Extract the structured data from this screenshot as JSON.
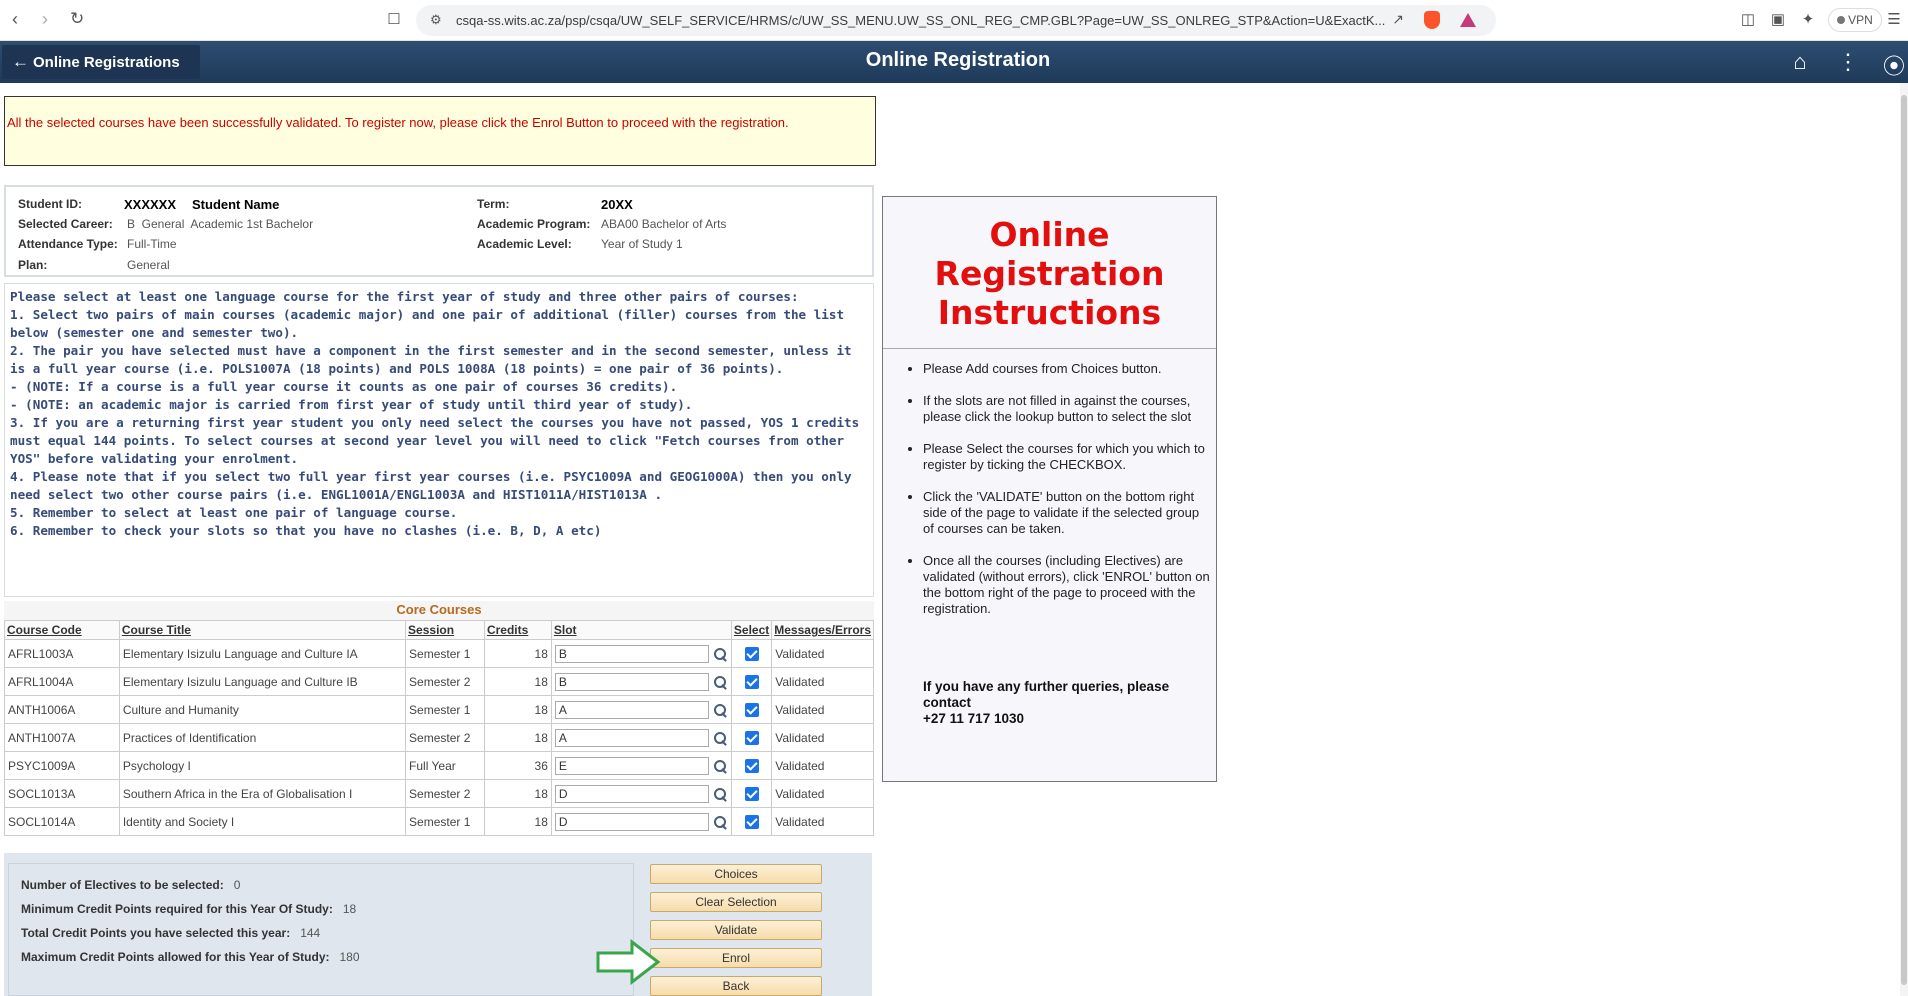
{
  "browser": {
    "url": "csqa-ss.wits.ac.za/psp/csqa/UW_SELF_SERVICE/HRMS/c/UW_SS_MENU.UW_SS_ONL_REG_CMP.GBL?Page=UW_SS_ONLREG_STP&Action=U&ExactK...",
    "vpn_label": "VPN"
  },
  "header": {
    "back_label": "Online Registrations",
    "title": "Online Registration"
  },
  "message": "All the selected courses have been successfully validated. To register now, please click the Enrol Button to proceed with the registration.",
  "student": {
    "id_label": "Student ID:",
    "id_value": "XXXXXX",
    "name_value": "Student Name",
    "career_label": "Selected Career:",
    "career_value": "B  General  Academic 1st Bachelor",
    "attendance_label": "Attendance Type:",
    "attendance_value": "Full-Time",
    "plan_label": "Plan:",
    "plan_value": "General",
    "term_label": "Term:",
    "term_value": "20XX",
    "program_label": "Academic Program:",
    "program_value": "ABA00 Bachelor of Arts",
    "level_label": "Academic Level:",
    "level_value": "Year of Study 1"
  },
  "instructions_text": [
    "Please select at least one language course for the first year of study and three other pairs of courses:",
    "",
    "1. Select two pairs of main courses (academic major) and one pair of additional (filler) courses from the list below (semester one and semester two).",
    "2. The pair you have selected must have a component in the first semester and in the second semester, unless it is a full year course (i.e. POLS1007A (18 points) and POLS 1008A (18 points) = one pair of 36 points).",
    "",
    "- (NOTE: If a course is a full year course it counts as one pair of courses 36 credits).",
    "- (NOTE: an academic major is carried from first year of study until third year of study).",
    "",
    "3. If you are a returning first year student you only need select the courses you have not passed, YOS 1 credits must equal 144 points. To select courses at second year level you will need to click \"Fetch courses from other YOS\" before validating your enrolment.",
    "4. Please note that if you select two full year first year courses (i.e. PSYC1009A and GEOG1000A) then you only need select two other course pairs (i.e. ENGL1001A/ENGL1003A and HIST1011A/HIST1013A .",
    "5. Remember to select at least one pair of language course.",
    "6. Remember to check your slots so that you have no clashes (i.e. B, D, A etc)"
  ],
  "core_courses": {
    "caption": "Core Courses",
    "headers": [
      "Course Code",
      "Course Title",
      "Session",
      "Credits",
      "Slot",
      "Select",
      "Messages/Errors"
    ],
    "rows": [
      {
        "code": "AFRL1003A",
        "title": "Elementary Isizulu Language and Culture IA",
        "session": "Semester 1",
        "credits": "18",
        "slot": "B",
        "status": "Validated"
      },
      {
        "code": "AFRL1004A",
        "title": "Elementary Isizulu Language and Culture IB",
        "session": "Semester 2",
        "credits": "18",
        "slot": "B",
        "status": "Validated"
      },
      {
        "code": "ANTH1006A",
        "title": "Culture and Humanity",
        "session": "Semester 1",
        "credits": "18",
        "slot": "A",
        "status": "Validated"
      },
      {
        "code": "ANTH1007A",
        "title": "Practices of Identification",
        "session": "Semester 2",
        "credits": "18",
        "slot": "A",
        "status": "Validated"
      },
      {
        "code": "PSYC1009A",
        "title": "Psychology I",
        "session": "Full Year",
        "credits": "36",
        "slot": "E",
        "status": "Validated"
      },
      {
        "code": "SOCL1013A",
        "title": "Southern Africa in the Era of Globalisation I",
        "session": "Semester 2",
        "credits": "18",
        "slot": "D",
        "status": "Validated"
      },
      {
        "code": "SOCL1014A",
        "title": "Identity and Society I",
        "session": "Semester 1",
        "credits": "18",
        "slot": "D",
        "status": "Validated"
      }
    ]
  },
  "summary": {
    "electives_label": "Number of Electives to be selected:",
    "electives_value": "0",
    "min_label": "Minimum Credit Points required for this Year Of Study:",
    "min_value": "18",
    "total_label": "Total Credit Points you have selected this year:",
    "total_value": "144",
    "max_label": "Maximum Credit Points allowed for this Year of Study:",
    "max_value": "180"
  },
  "buttons": {
    "choices": "Choices",
    "clear": "Clear Selection",
    "validate": "Validate",
    "enrol": "Enrol",
    "back": "Back"
  },
  "side_card": {
    "title": "Online Registration Instructions",
    "items": [
      "Please Add courses from Choices button.",
      "If the slots are not filled in against the courses, please click the lookup button to select the slot",
      "Please Select the courses for which you which to register by ticking the CHECKBOX.",
      "Click the 'VALIDATE' button on the bottom right side of the page to validate if the selected group of courses can be taken.",
      "Once all the courses (including Electives) are validated (without errors), click 'ENROL' button on the bottom right of the page to proceed with the registration."
    ],
    "contact_line1": "If you have any further queries, please contact",
    "contact_line2": "+27 11 717 1030"
  },
  "colors": {
    "header_bg": "#1f3a5a",
    "message_text": "#cc0000",
    "side_title": "#e30e0e",
    "instructions_text": "#364b7a",
    "button_bg": "#f7dcab",
    "arrow": "#3aa64a"
  }
}
